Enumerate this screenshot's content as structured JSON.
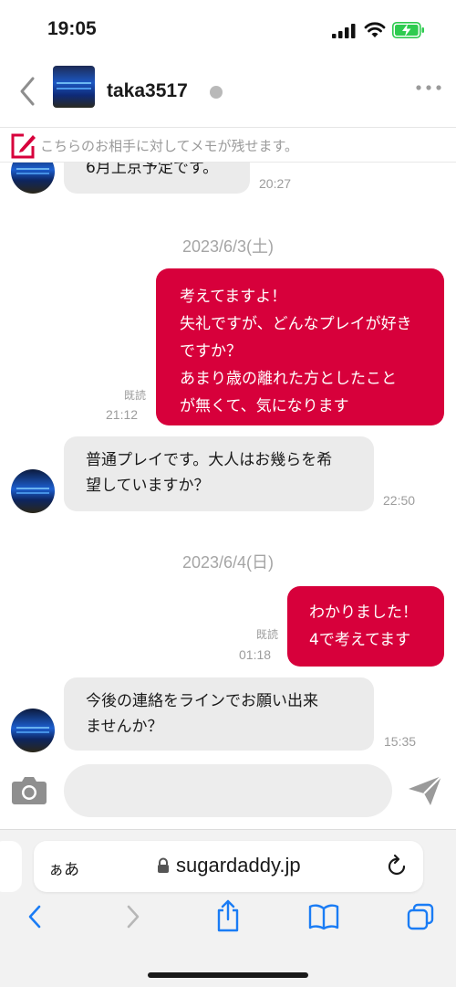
{
  "status_bar": {
    "time": "19:05"
  },
  "header": {
    "username": "taka3517",
    "online_status": "offline-gray-dot"
  },
  "memo": {
    "placeholder": "こちらのお相手に対してメモが残せます。"
  },
  "messages": {
    "m0": {
      "lines": [
        "6月上京予定です。"
      ],
      "time": "20:27"
    },
    "date1": "2023/6/3(土)",
    "m1": {
      "lines": [
        "考えてますよ！",
        "失礼ですが、どんなプレイが好き",
        "ですか？",
        "あまり歳の離れた方としたこと",
        "が無くて、気になります"
      ],
      "read": "既読",
      "time": "21:12"
    },
    "m2": {
      "lines": [
        "普通プレイです。大人はお幾らを希",
        "望していますか？"
      ],
      "time": "22:50"
    },
    "date2": "2023/6/4(日)",
    "m3": {
      "lines": [
        "わかりました！",
        "4で考えてます"
      ],
      "read": "既読",
      "time": "01:18"
    },
    "m4": {
      "lines": [
        "今後の連絡をラインでお願い出来",
        "ませんか？"
      ],
      "time": "15:35"
    }
  },
  "composer": {
    "value": ""
  },
  "safari": {
    "aa_label": "ぁあ",
    "url": "sugardaddy.jp"
  },
  "colors": {
    "accent": "#d7003b",
    "incoming_bubble": "#ebebeb",
    "ios_blue": "#1a7cf5"
  },
  "icons": [
    "back-chevron-icon",
    "more-icon",
    "memo-icon",
    "camera-icon",
    "send-icon",
    "lock-icon",
    "reload-icon",
    "back-icon",
    "forward-icon",
    "share-icon",
    "bookmarks-icon",
    "tabs-icon"
  ]
}
